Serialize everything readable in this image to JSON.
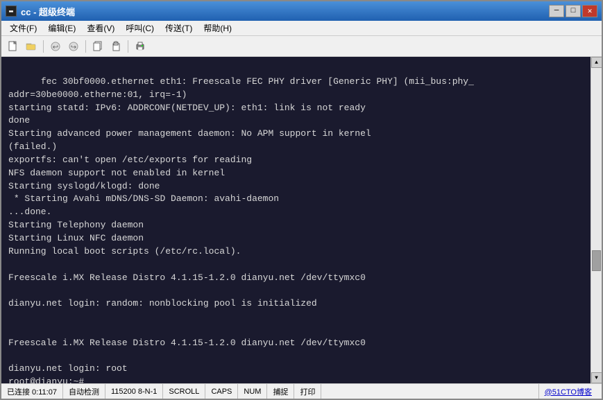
{
  "window": {
    "title": "cc - 超级终端",
    "title_icon": "▬"
  },
  "title_buttons": {
    "minimize": "─",
    "maximize": "□",
    "close": "✕"
  },
  "menu": {
    "items": [
      {
        "label": "文件(F)"
      },
      {
        "label": "编辑(E)"
      },
      {
        "label": "查看(V)"
      },
      {
        "label": "呼叫(C)"
      },
      {
        "label": "传送(T)"
      },
      {
        "label": "帮助(H)"
      }
    ]
  },
  "toolbar": {
    "buttons": [
      {
        "name": "new-btn",
        "icon": "📄"
      },
      {
        "name": "open-btn",
        "icon": "📂"
      },
      {
        "name": "back-btn",
        "icon": "↩"
      },
      {
        "name": "forward-btn",
        "icon": "⚡"
      },
      {
        "name": "copy-btn",
        "icon": "📋"
      },
      {
        "name": "paste-btn",
        "icon": "📌"
      },
      {
        "name": "print-btn",
        "icon": "🖨"
      }
    ]
  },
  "terminal": {
    "content": "fec 30bf0000.ethernet eth1: Freescale FEC PHY driver [Generic PHY] (mii_bus:phy_\naddr=30be0000.etherne:01, irq=-1)\nstarting statd: IPv6: ADDRCONF(NETDEV_UP): eth1: link is not ready\ndone\nStarting advanced power management daemon: No APM support in kernel\n(failed.)\nexportfs: can't open /etc/exports for reading\nNFS daemon support not enabled in kernel\nStarting syslogd/klogd: done\n * Starting Avahi mDNS/DNS-SD Daemon: avahi-daemon\n...done.\nStarting Telephony daemon\nStarting Linux NFC daemon\nRunning local boot scripts (/etc/rc.local).\n\nFreescale i.MX Release Distro 4.1.15-1.2.0 dianyu.net /dev/ttymxc0\n\ndianyu.net login: random: nonblocking pool is initialized\n\n\nFreescale i.MX Release Distro 4.1.15-1.2.0 dianyu.net /dev/ttymxc0\n\ndianyu.net login: root\nroot@dianyu:~#"
  },
  "status_bar": {
    "connected": "已连接 0:11:07",
    "auto_detect": "自动检测",
    "baud": "115200 8-N-1",
    "scroll": "SCROLL",
    "caps": "CAPS",
    "num": "NUM",
    "capture": "捕捉",
    "print": "打印",
    "site": "@51CTO博客"
  }
}
